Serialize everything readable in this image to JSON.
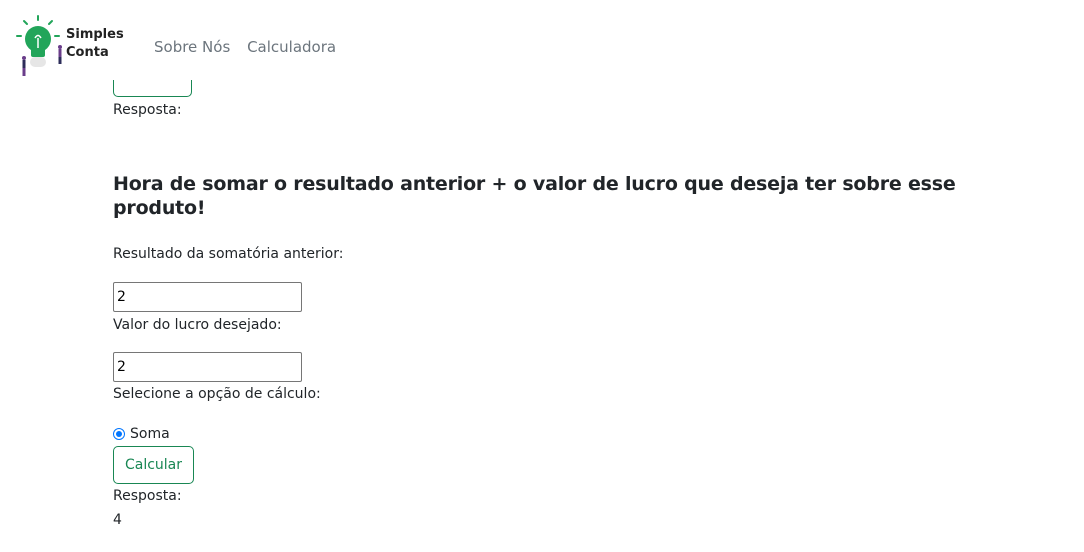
{
  "brand": {
    "line1": "Simples",
    "line2": "Conta",
    "logo_icon": "lightbulb-icon",
    "accent_color": "#22a55a"
  },
  "nav": {
    "items": [
      {
        "label": "Sobre Nós"
      },
      {
        "label": "Calculadora"
      }
    ]
  },
  "previous": {
    "response_label": "Resposta:"
  },
  "section": {
    "heading": "Hora de somar o resultado anterior + o valor de lucro que deseja ter sobre esse produto!",
    "field1_label": "Resultado da somatória anterior:",
    "field1_value": "2",
    "field2_label": "Valor do lucro desejado:",
    "field2_value": "2",
    "option_label": "Selecione a opção de cálculo:",
    "radio_label": "Soma",
    "button_label": "Calcular",
    "response_label": "Resposta:",
    "response_value": "4"
  },
  "colors": {
    "button_border": "#198754",
    "radio": "#0075ff",
    "nav_link": "#6c757d"
  }
}
